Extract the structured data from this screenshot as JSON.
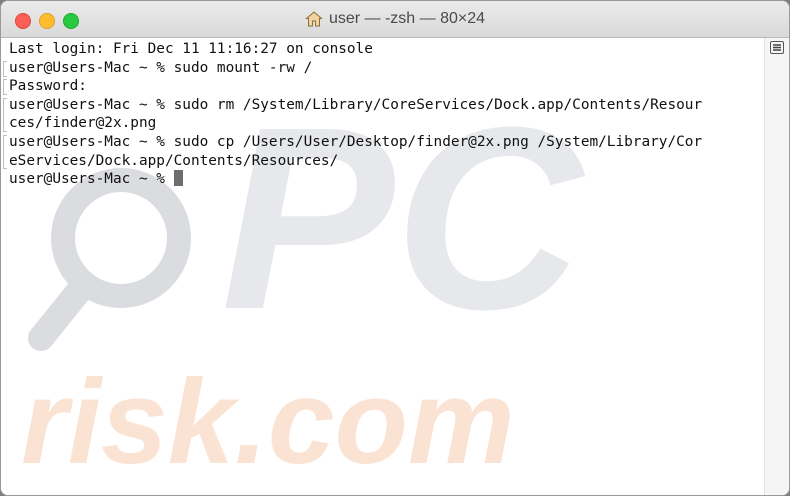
{
  "window": {
    "title": "user — -zsh — 80×24"
  },
  "terminal": {
    "lines": [
      "Last login: Fri Dec 11 11:16:27 on console",
      "user@Users-Mac ~ % sudo mount -rw /",
      "Password:",
      "user@Users-Mac ~ % sudo rm /System/Library/CoreServices/Dock.app/Contents/Resour",
      "ces/finder@2x.png",
      "user@Users-Mac ~ % sudo cp /Users/User/Desktop/finder@2x.png /System/Library/Cor",
      "eServices/Dock.app/Contents/Resources/"
    ],
    "prompt": "user@Users-Mac ~ % "
  },
  "watermark": {
    "top": "PC",
    "bottom": "risk.com"
  },
  "colors": {
    "watermark_gray": "#dadcdf",
    "watermark_orange": "#fbe3d3",
    "close": "#fd5f57",
    "minimize": "#febc2e",
    "zoom": "#28c840"
  },
  "icons": {
    "title": "home-icon",
    "split": "split-pane-icon"
  }
}
